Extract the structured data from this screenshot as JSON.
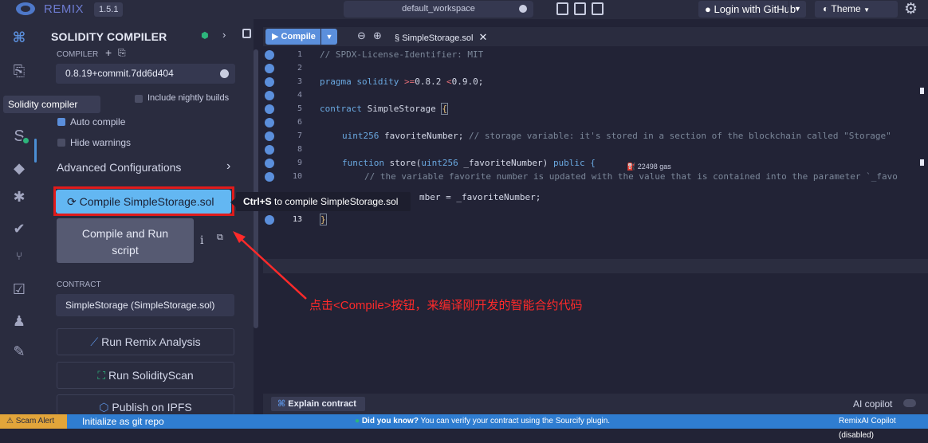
{
  "topbar": {
    "app_name": "REMIX",
    "version": "1.5.1",
    "workspace": "default_workspace",
    "login_label": "Login with GitHub",
    "theme_label": "Theme"
  },
  "sidebar_icons": [
    "remix-logo-icon",
    "file-explorer-icon",
    "solidity-compiler-icon",
    "deploy-icon",
    "debugger-icon",
    "test-icon",
    "git-icon",
    "analysis-icon",
    "learn-icon",
    "plugin-manager-icon"
  ],
  "side_panel": {
    "title": "SOLIDITY COMPILER",
    "compiler_label": "COMPILER",
    "compiler_version": "0.8.19+commit.7dd6d404",
    "include_nightly": "Include nightly builds",
    "tooltip_solidity": "Solidity compiler",
    "auto_compile": "Auto compile",
    "hide_warnings": "Hide warnings",
    "advanced": "Advanced Configurations",
    "compile_button": "Compile SimpleStorage.sol",
    "compile_run_line1": "Compile and Run",
    "compile_run_line2": "script",
    "info": "i",
    "contract_label": "CONTRACT",
    "contract_value": "SimpleStorage (SimpleStorage.sol)",
    "run_remix_analysis": "Run Remix Analysis",
    "run_solidityscan": "Run SolidityScan",
    "publish_ipfs": "Publish on IPFS"
  },
  "tooltip": {
    "shortcut": "Ctrl+S",
    "text": " to compile SimpleStorage.sol"
  },
  "editor": {
    "compile_btn": "Compile",
    "file_tab": "SimpleStorage.sol",
    "gas": "22498 gas",
    "lines": {
      "l1": "// SPDX-License-Identifier: MIT",
      "l3_kw": "pragma solidity ",
      "l3_op1": ">=",
      "l3_num1": "0.8.2 ",
      "l3_op2": "<",
      "l3_num2": "0.9.0",
      "l3_end": ";",
      "l5_kw": "contract ",
      "l5_name": "SimpleStorage ",
      "l5_brace": "{",
      "l7_kw": "uint256 ",
      "l7_code": "favoriteNumber; ",
      "l7_comment": "// storage variable: it's stored in a section of the blockchain called \"Storage\"",
      "l9_kw": "function ",
      "l9_code": "store(",
      "l9_kw2": "uint256 ",
      "l9_code2": "_favoriteNumber) ",
      "l9_kw3": "public ",
      "l9_brace": "{",
      "l10_comment": "// the variable favorite number is updated with the value that is contained into the parameter `_favo",
      "l11_code": "mber = _favoriteNumber;",
      "l13_brace": "}"
    }
  },
  "annotation": "点击<Compile>按钮，来编译刚开发的智能合约代码",
  "bottom": {
    "explain": "Explain contract",
    "copilot": "AI copilot"
  },
  "statusbar": {
    "scam": "Scam Alert",
    "git": "Initialize as git repo",
    "dyk_bold": "Did you know?",
    "dyk_text": "  You can verify your contract using the Sourcify plugin.",
    "copilot_status": "RemixAI Copilot (disabled)"
  },
  "colors": {
    "accent": "#5b8fdc",
    "compile_button": "#63b7f2",
    "highlight_red": "#e01b1b",
    "statusbar": "#2f7dd1"
  }
}
